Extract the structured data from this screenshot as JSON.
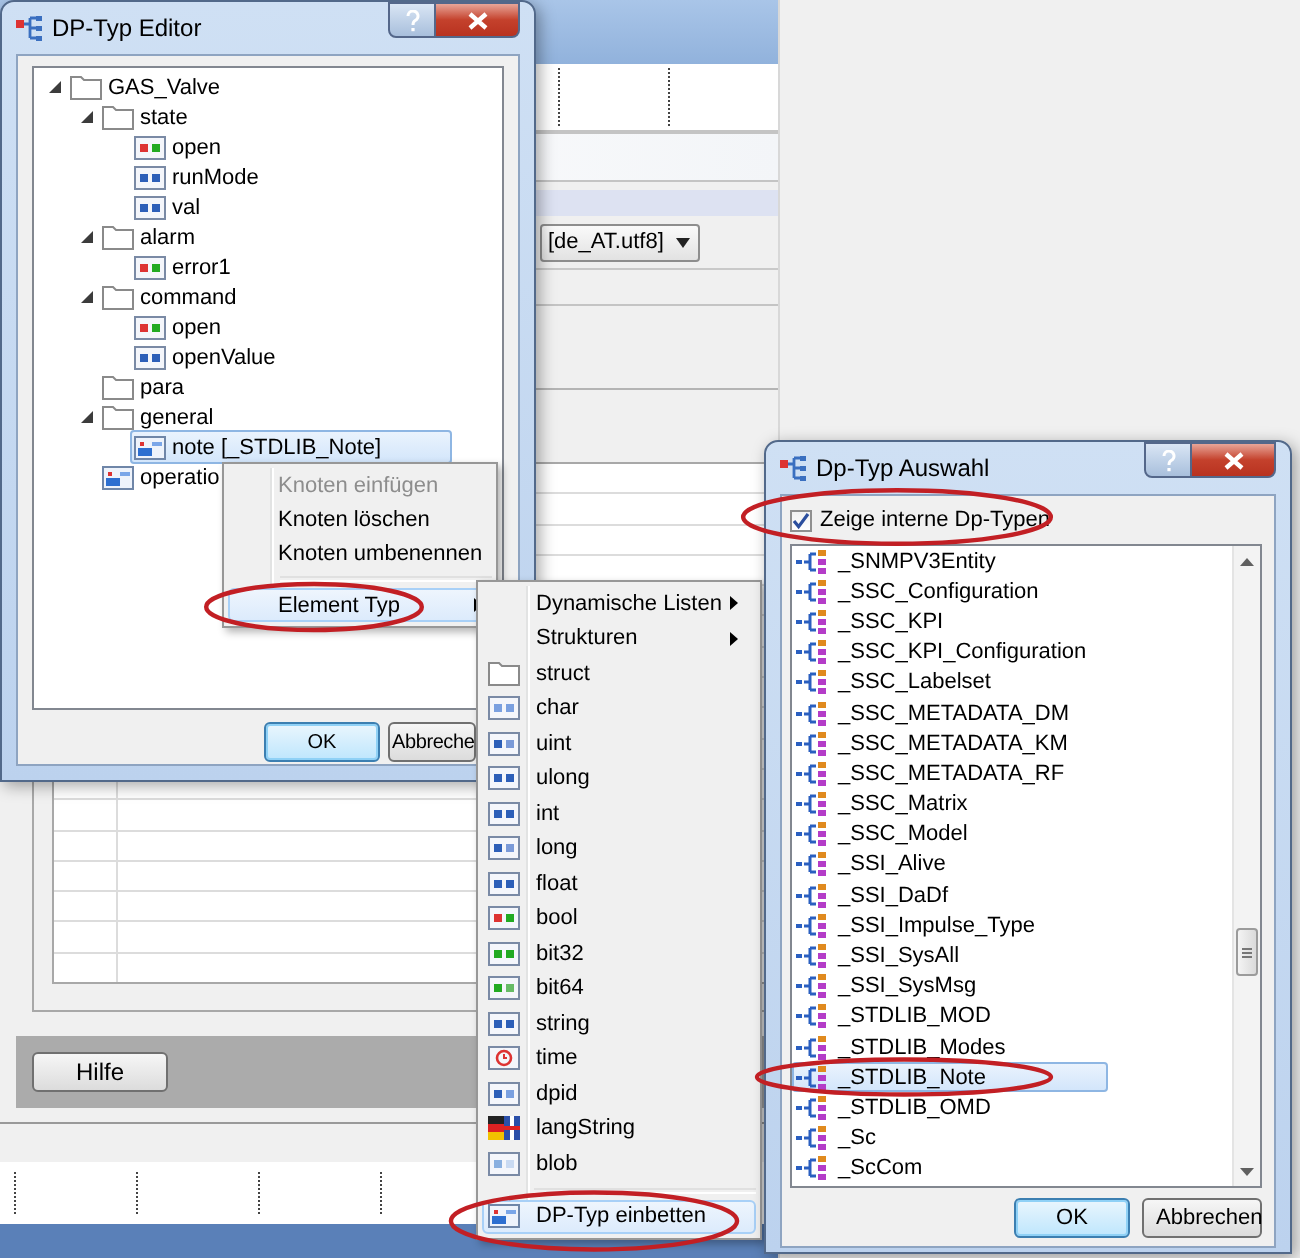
{
  "background_window": {
    "locale_dropdown": "[de_AT.utf8]",
    "help_button": "Hilfe"
  },
  "type_editor": {
    "title": "DP-Typ Editor",
    "tree": [
      {
        "label": "GAS_Valve",
        "kind": "folder",
        "expanded": true,
        "selected": false,
        "children": [
          {
            "label": "state",
            "kind": "folder",
            "expanded": true,
            "selected": false,
            "children": [
              {
                "label": "open",
                "kind": "bool",
                "selected": false
              },
              {
                "label": "runMode",
                "kind": "int",
                "selected": false
              },
              {
                "label": "val",
                "kind": "float",
                "selected": false
              }
            ]
          },
          {
            "label": "alarm",
            "kind": "folder",
            "expanded": true,
            "selected": false,
            "children": [
              {
                "label": "error1",
                "kind": "bool",
                "selected": false
              }
            ]
          },
          {
            "label": "command",
            "kind": "folder",
            "expanded": true,
            "selected": false,
            "children": [
              {
                "label": "open",
                "kind": "bool",
                "selected": false
              },
              {
                "label": "openValue",
                "kind": "float",
                "selected": false
              }
            ]
          },
          {
            "label": "para",
            "kind": "folder",
            "selected": false
          },
          {
            "label": "general",
            "kind": "folder",
            "expanded": true,
            "selected": false,
            "children": [
              {
                "label": "note [_STDLIB_Note]",
                "kind": "embed",
                "selected": true
              }
            ]
          },
          {
            "label": "operatio",
            "kind": "embed",
            "selected": false
          }
        ]
      }
    ],
    "buttons": [
      {
        "label": "OK",
        "default": true
      },
      {
        "label": "Abbreche",
        "default": false
      }
    ]
  },
  "context_menu": {
    "items": [
      {
        "kind": "action",
        "label": "Knoten einfügen",
        "disabled": true,
        "selected": false,
        "submenu": false,
        "circled": false
      },
      {
        "kind": "action",
        "label": "Knoten löschen",
        "disabled": false,
        "selected": false,
        "submenu": false,
        "circled": false
      },
      {
        "kind": "action",
        "label": "Knoten umbenennen",
        "disabled": false,
        "selected": false,
        "submenu": false,
        "circled": false
      },
      {
        "kind": "separator"
      },
      {
        "kind": "action",
        "label": "Element Typ",
        "disabled": false,
        "selected": true,
        "submenu": true,
        "circled": true
      }
    ]
  },
  "submenu": {
    "items": [
      {
        "kind": "list",
        "label": "Dynamische Listen",
        "submenu": true,
        "selected": false,
        "circled": false
      },
      {
        "kind": "list",
        "label": "Strukturen",
        "submenu": true,
        "selected": false,
        "circled": false
      },
      {
        "kind": "folder",
        "label": "struct",
        "submenu": false,
        "selected": false,
        "circled": false
      },
      {
        "kind": "char",
        "label": "char",
        "submenu": false,
        "selected": false,
        "circled": false
      },
      {
        "kind": "uint",
        "label": "uint",
        "submenu": false,
        "selected": false,
        "circled": false
      },
      {
        "kind": "ulong",
        "label": "ulong",
        "submenu": false,
        "selected": false,
        "circled": false
      },
      {
        "kind": "int",
        "label": "int",
        "submenu": false,
        "selected": false,
        "circled": false
      },
      {
        "kind": "long",
        "label": "long",
        "submenu": false,
        "selected": false,
        "circled": false
      },
      {
        "kind": "float",
        "label": "float",
        "submenu": false,
        "selected": false,
        "circled": false
      },
      {
        "kind": "bool",
        "label": "bool",
        "submenu": false,
        "selected": false,
        "circled": false
      },
      {
        "kind": "bit32",
        "label": "bit32",
        "submenu": false,
        "selected": false,
        "circled": false
      },
      {
        "kind": "bit64",
        "label": "bit64",
        "submenu": false,
        "selected": false,
        "circled": false
      },
      {
        "kind": "string",
        "label": "string",
        "submenu": false,
        "selected": false,
        "circled": false
      },
      {
        "kind": "time",
        "label": "time",
        "submenu": false,
        "selected": false,
        "circled": false
      },
      {
        "kind": "dpid",
        "label": "dpid",
        "submenu": false,
        "selected": false,
        "circled": false
      },
      {
        "kind": "lang",
        "label": "langString",
        "submenu": false,
        "selected": false,
        "circled": false
      },
      {
        "kind": "blob",
        "label": "blob",
        "submenu": false,
        "selected": false,
        "circled": false
      },
      {
        "kind": "separator"
      },
      {
        "kind": "embed",
        "label": "DP-Typ einbetten",
        "submenu": false,
        "selected": true,
        "circled": true
      }
    ]
  },
  "type_selection": {
    "title": "Dp-Typ Auswahl",
    "show_internal": {
      "label": "Zeige interne Dp-Typen",
      "checked": true,
      "circled": true
    },
    "types": [
      {
        "name": "_SNMPV3Entity",
        "selected": false,
        "circled": false
      },
      {
        "name": "_SSC_Configuration",
        "selected": false,
        "circled": false
      },
      {
        "name": "_SSC_KPI",
        "selected": false,
        "circled": false
      },
      {
        "name": "_SSC_KPI_Configuration",
        "selected": false,
        "circled": false
      },
      {
        "name": "_SSC_Labelset",
        "selected": false,
        "circled": false
      },
      {
        "name": "_SSC_METADATA_DM",
        "selected": false,
        "circled": false
      },
      {
        "name": "_SSC_METADATA_KM",
        "selected": false,
        "circled": false
      },
      {
        "name": "_SSC_METADATA_RF",
        "selected": false,
        "circled": false
      },
      {
        "name": "_SSC_Matrix",
        "selected": false,
        "circled": false
      },
      {
        "name": "_SSC_Model",
        "selected": false,
        "circled": false
      },
      {
        "name": "_SSI_Alive",
        "selected": false,
        "circled": false
      },
      {
        "name": "_SSI_DaDf",
        "selected": false,
        "circled": false
      },
      {
        "name": "_SSI_Impulse_Type",
        "selected": false,
        "circled": false
      },
      {
        "name": "_SSI_SysAll",
        "selected": false,
        "circled": false
      },
      {
        "name": "_SSI_SysMsg",
        "selected": false,
        "circled": false
      },
      {
        "name": "_STDLIB_MOD",
        "selected": false,
        "circled": false
      },
      {
        "name": "_STDLIB_Modes",
        "selected": false,
        "circled": false
      },
      {
        "name": "_STDLIB_Note",
        "selected": true,
        "circled": true
      },
      {
        "name": "_STDLIB_OMD",
        "selected": false,
        "circled": false
      },
      {
        "name": "_Sc",
        "selected": false,
        "circled": false
      },
      {
        "name": "_ScCom",
        "selected": false,
        "circled": false
      }
    ],
    "buttons": [
      {
        "label": "OK",
        "default": true
      },
      {
        "label": "Abbrechen",
        "default": false
      }
    ]
  }
}
